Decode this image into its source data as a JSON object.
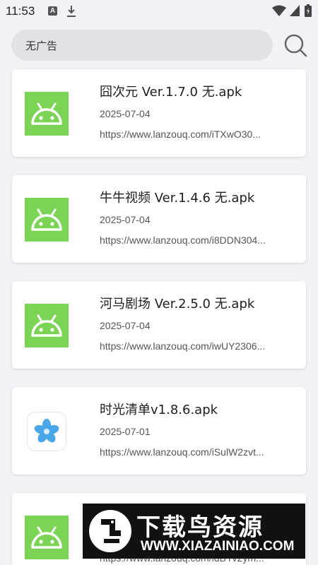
{
  "status_bar": {
    "time": "11:53",
    "notification_icons": [
      "text-a-icon",
      "download-icon"
    ],
    "system_icons": [
      "wifi-icon",
      "signal-icon",
      "battery-icon"
    ]
  },
  "search": {
    "value": "无广告",
    "button_icon": "search-icon"
  },
  "results": [
    {
      "title": "囧次元 Ver.1.7.0 无.apk",
      "date": "2025-07-04",
      "url": "https://www.lanzouq.com/iTXwO30...",
      "icon": "android-icon"
    },
    {
      "title": "牛牛视频 Ver.1.4.6 无.apk",
      "date": "2025-07-04",
      "url": "https://www.lanzouq.com/i8DDN304...",
      "icon": "android-icon"
    },
    {
      "title": "河马剧场 Ver.2.5.0 无.apk",
      "date": "2025-07-04",
      "url": "https://www.lanzouq.com/iwUY2306...",
      "icon": "android-icon"
    },
    {
      "title": "时光清单v1.8.6.apk",
      "date": "2025-07-01",
      "url": "https://www.lanzouq.com/iSulW2zvt...",
      "icon": "flower-icon"
    },
    {
      "title": "",
      "date": "",
      "url": "https://www.lanzouq.com/idBYv2ym...",
      "icon": "android-icon"
    }
  ],
  "watermark": {
    "title": "下载鸟资源",
    "url": "WWW.XIAZAINIAO.COM"
  },
  "colors": {
    "background": "#f2f2f6",
    "search_box": "#e2e2e6",
    "card": "#ffffff",
    "android_green": "#7bd456",
    "flower_blue": "#4aa6e6"
  }
}
